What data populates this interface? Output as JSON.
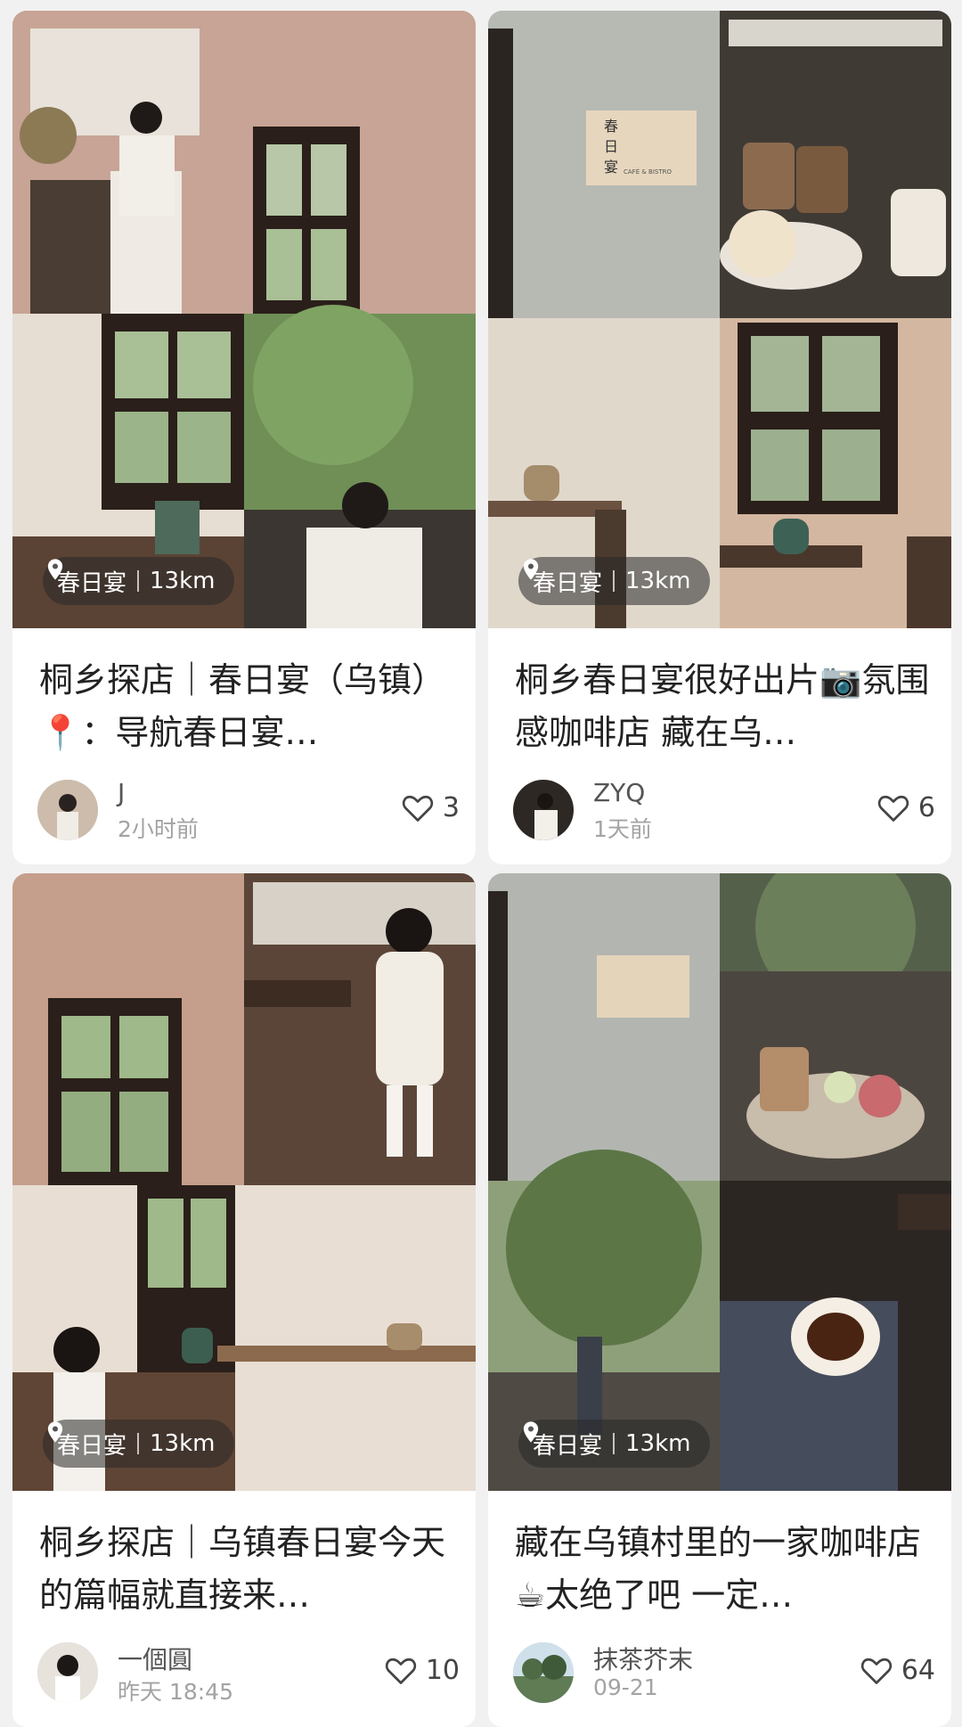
{
  "feed": {
    "cards": [
      {
        "location": "春日宴",
        "distance": "13km",
        "title": "桐乡探店｜春日宴（乌镇）📍：导航春日宴…",
        "author": "J",
        "time": "2小时前",
        "likes": "3"
      },
      {
        "location": "春日宴",
        "distance": "13km",
        "title": "桐乡春日宴很好出片📷氛围感咖啡店 藏在乌…",
        "author": "ZYQ",
        "time": "1天前",
        "likes": "6"
      },
      {
        "location": "春日宴",
        "distance": "13km",
        "title": "桐乡探店｜乌镇春日宴今天的篇幅就直接来…",
        "author": "一個圓",
        "time": "昨天 18:45",
        "likes": "10"
      },
      {
        "location": "春日宴",
        "distance": "13km",
        "title": "藏在乌镇村里的一家咖啡店☕太绝了吧 一定…",
        "author": "抹茶芥末",
        "time": "09-21",
        "likes": "64"
      }
    ]
  },
  "signboard": {
    "line1": "春",
    "line2": "日",
    "line3": "宴",
    "sub": "CAFÉ & BISTRO"
  },
  "icons": {
    "location": "location-pin-icon",
    "like": "heart-outline-icon"
  }
}
